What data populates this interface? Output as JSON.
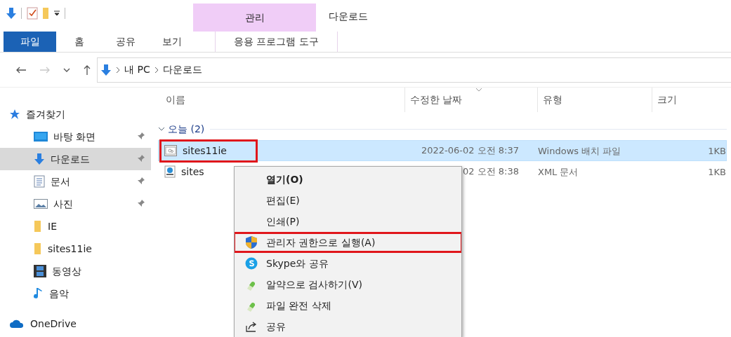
{
  "window": {
    "title": "다운로드"
  },
  "ribbon": {
    "context_group": "관리",
    "tabs": [
      {
        "label": "파일",
        "kind": "file"
      },
      {
        "label": "홈",
        "kind": "normal"
      },
      {
        "label": "공유",
        "kind": "normal"
      },
      {
        "label": "보기",
        "kind": "normal"
      },
      {
        "label": "응용 프로그램 도구",
        "kind": "contextual"
      }
    ]
  },
  "address_bar": {
    "forward_disabled": true,
    "crumbs": [
      "내 PC",
      "다운로드"
    ]
  },
  "sidebar": {
    "items": [
      {
        "label": "즐겨찾기",
        "kind": "star",
        "children": [
          {
            "label": "바탕 화면",
            "kind": "desktop",
            "pinned": true,
            "selected": false
          },
          {
            "label": "다운로드",
            "kind": "download",
            "pinned": true,
            "selected": true
          },
          {
            "label": "문서",
            "kind": "document",
            "pinned": true,
            "selected": false
          },
          {
            "label": "사진",
            "kind": "picture",
            "pinned": true,
            "selected": false
          },
          {
            "label": "IE",
            "kind": "folder",
            "pinned": false,
            "selected": false
          },
          {
            "label": "sites11ie",
            "kind": "folder",
            "pinned": false,
            "selected": false
          },
          {
            "label": "동영상",
            "kind": "video",
            "pinned": false,
            "selected": false
          },
          {
            "label": "음악",
            "kind": "music",
            "pinned": false,
            "selected": false
          }
        ]
      },
      {
        "label": "OneDrive",
        "kind": "cloud"
      }
    ]
  },
  "table": {
    "columns": [
      {
        "label": "이름",
        "sorted": false
      },
      {
        "label": "수정한 날짜",
        "sorted": true
      },
      {
        "label": "유형",
        "sorted": false
      },
      {
        "label": "크기",
        "sorted": false
      }
    ],
    "group": {
      "label": "오늘 (2)",
      "expanded": true
    },
    "rows": [
      {
        "name": "sites11ie",
        "kind": "batch",
        "modified": "2022-06-02 오전 8:37",
        "type": "Windows 배치 파일",
        "size": "1KB",
        "selected": true,
        "annotated": true
      },
      {
        "name": "sites",
        "kind": "xml",
        "modified": "02 오전 8:38",
        "type": "XML 문서",
        "size": "1KB",
        "selected": false,
        "annotated": false
      }
    ]
  },
  "context_menu": {
    "items": [
      {
        "label": "열기(O)",
        "kind": "plain",
        "default": true,
        "annotated": false
      },
      {
        "label": "편집(E)",
        "kind": "plain",
        "default": false,
        "annotated": false
      },
      {
        "label": "인쇄(P)",
        "kind": "plain",
        "default": false,
        "annotated": false
      },
      {
        "label": "관리자 권한으로 실행(A)",
        "kind": "shield",
        "default": false,
        "annotated": true
      },
      {
        "label": "Skype와 공유",
        "kind": "skype",
        "default": false,
        "annotated": false
      },
      {
        "label": "알약으로 검사하기(V)",
        "kind": "pill",
        "default": false,
        "annotated": false
      },
      {
        "label": "파일 완전 삭제",
        "kind": "pill",
        "default": false,
        "annotated": false
      },
      {
        "label": "공유",
        "kind": "share",
        "default": false,
        "annotated": false
      }
    ]
  }
}
